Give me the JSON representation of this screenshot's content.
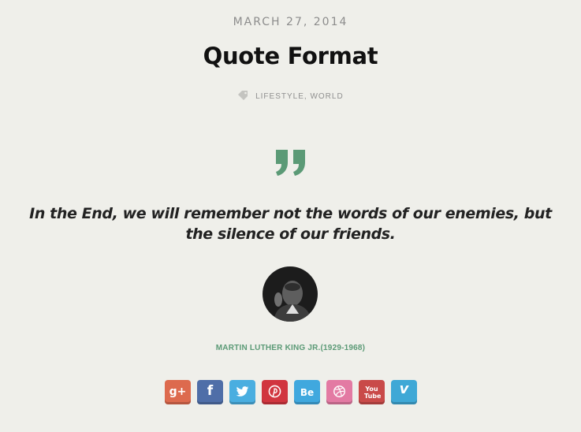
{
  "post": {
    "date": "MARCH 27, 2014",
    "title": "Quote Format",
    "categories": [
      "LIFESTYLE",
      "WORLD"
    ],
    "category_separator": ", ",
    "quote": "In the End, we will remember not the words of our enemies, but the silence of our friends.",
    "author": "MARTIN LUTHER KING JR.(1929-1968)"
  },
  "share": [
    {
      "name": "google-plus",
      "glyph": "g+",
      "color": "#dd6a4e"
    },
    {
      "name": "facebook",
      "glyph": "f",
      "color": "#4f6ea8"
    },
    {
      "name": "twitter",
      "glyph": "",
      "color": "#4aaee0"
    },
    {
      "name": "pinterest",
      "glyph": "",
      "color": "#d1353f"
    },
    {
      "name": "behance",
      "glyph": "Be",
      "color": "#40a8de"
    },
    {
      "name": "dribbble",
      "glyph": "",
      "color": "#e37aa3"
    },
    {
      "name": "youtube",
      "glyph": "You Tube",
      "color": "#c94a49"
    },
    {
      "name": "vimeo",
      "glyph": "v",
      "color": "#3fa8d6"
    }
  ],
  "colors": {
    "accent": "#5b9a76",
    "background": "#efefea"
  }
}
